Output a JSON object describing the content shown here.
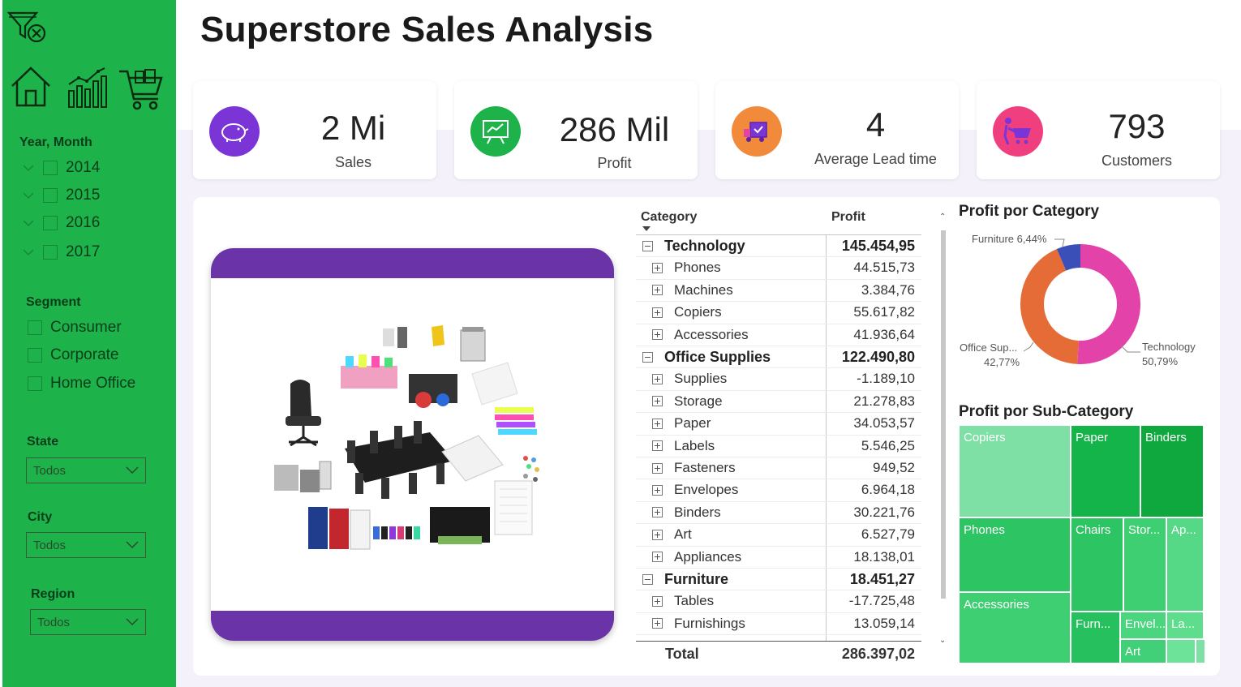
{
  "page": {
    "title": "Superstore Sales Analysis"
  },
  "sidebar": {
    "filters": {
      "year_month": {
        "title": "Year, Month",
        "years": [
          "2014",
          "2015",
          "2016",
          "2017"
        ]
      },
      "segment": {
        "title": "Segment",
        "options": [
          "Consumer",
          "Corporate",
          "Home Office"
        ]
      },
      "state": {
        "title": "State",
        "value": "Todos"
      },
      "city": {
        "title": "City",
        "value": "Todos"
      },
      "region": {
        "title": "Region",
        "value": "Todos"
      }
    },
    "icons": [
      "filter-clear-icon",
      "home-icon",
      "chart-icon",
      "cart-icon"
    ]
  },
  "kpis": [
    {
      "value": "2 Mi",
      "label": "Sales",
      "color": "#7b35d6",
      "icon": "piggy-bank-icon"
    },
    {
      "value": "286 Mil",
      "label": "Profit",
      "color": "#1db24a",
      "icon": "presentation-chart-icon"
    },
    {
      "value": "4",
      "label": "Average Lead time",
      "color": "#f28a3c",
      "icon": "delivery-truck-icon"
    },
    {
      "value": "793",
      "label": "Customers",
      "color": "#f03f7f",
      "icon": "shopping-cart-person-icon"
    }
  ],
  "matrix": {
    "headers": {
      "category": "Category",
      "profit": "Profit"
    },
    "groups": [
      {
        "name": "Technology",
        "value": "145.454,95",
        "children": [
          {
            "name": "Phones",
            "value": "44.515,73"
          },
          {
            "name": "Machines",
            "value": "3.384,76"
          },
          {
            "name": "Copiers",
            "value": "55.617,82"
          },
          {
            "name": "Accessories",
            "value": "41.936,64"
          }
        ]
      },
      {
        "name": "Office Supplies",
        "value": "122.490,80",
        "children": [
          {
            "name": "Supplies",
            "value": "-1.189,10"
          },
          {
            "name": "Storage",
            "value": "21.278,83"
          },
          {
            "name": "Paper",
            "value": "34.053,57"
          },
          {
            "name": "Labels",
            "value": "5.546,25"
          },
          {
            "name": "Fasteners",
            "value": "949,52"
          },
          {
            "name": "Envelopes",
            "value": "6.964,18"
          },
          {
            "name": "Binders",
            "value": "30.221,76"
          },
          {
            "name": "Art",
            "value": "6.527,79"
          },
          {
            "name": "Appliances",
            "value": "18.138,01"
          }
        ]
      },
      {
        "name": "Furniture",
        "value": "18.451,27",
        "children": [
          {
            "name": "Tables",
            "value": "-17.725,48"
          },
          {
            "name": "Furnishings",
            "value": "13.059,14"
          }
        ]
      }
    ],
    "total": {
      "label": "Total",
      "value": "286.397,02"
    }
  },
  "donut": {
    "title": "Profit por Category",
    "labels": [
      {
        "text": "Furniture 6,44%"
      },
      {
        "text": "Office Sup...",
        "pct": "42,77%"
      },
      {
        "text": "Technology",
        "pct": "50,79%"
      }
    ]
  },
  "treemap": {
    "title": "Profit por Sub-Category",
    "cells": [
      "Copiers",
      "Paper",
      "Binders",
      "Phones",
      "Chairs",
      "Stor...",
      "Ap...",
      "Accessories",
      "Furn...",
      "Envel...",
      "La...",
      "Art"
    ]
  },
  "chart_data": [
    {
      "type": "pie",
      "title": "Profit por Category",
      "categories": [
        "Technology",
        "Office Supplies",
        "Furniture"
      ],
      "values": [
        50.79,
        42.77,
        6.44
      ],
      "colors": [
        "#e342a9",
        "#e66c37",
        "#3b4fb8"
      ],
      "legend": "none"
    }
  ]
}
